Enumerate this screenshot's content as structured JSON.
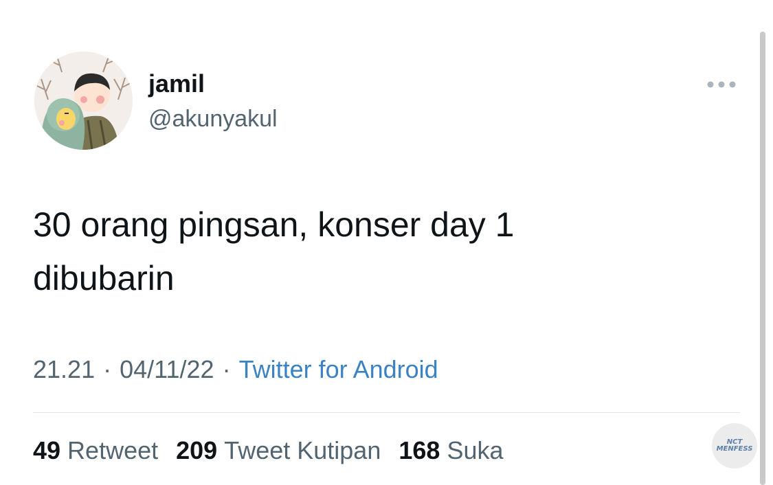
{
  "tweet": {
    "author": {
      "display_name": "jamil",
      "handle": "@akunyakul",
      "avatar_icon": "couple-cartoon-avatar-icon"
    },
    "more_icon": "more-options-icon",
    "text": "30 orang pingsan, konser day 1\ndibubarin",
    "meta": {
      "time": "21.21",
      "separator": "·",
      "date": "04/11/22",
      "source": "Twitter for Android"
    },
    "stats": {
      "retweets": {
        "count": "49",
        "label": "Retweet"
      },
      "quotes": {
        "count": "209",
        "label": "Tweet Kutipan"
      },
      "likes": {
        "count": "168",
        "label": "Suka"
      }
    }
  },
  "watermark": {
    "line1": "NCT",
    "line2": "MENFESS"
  },
  "colors": {
    "text_primary": "#0f1419",
    "text_secondary": "#536471",
    "link": "#3b82c4",
    "divider": "#dfe3e6"
  }
}
